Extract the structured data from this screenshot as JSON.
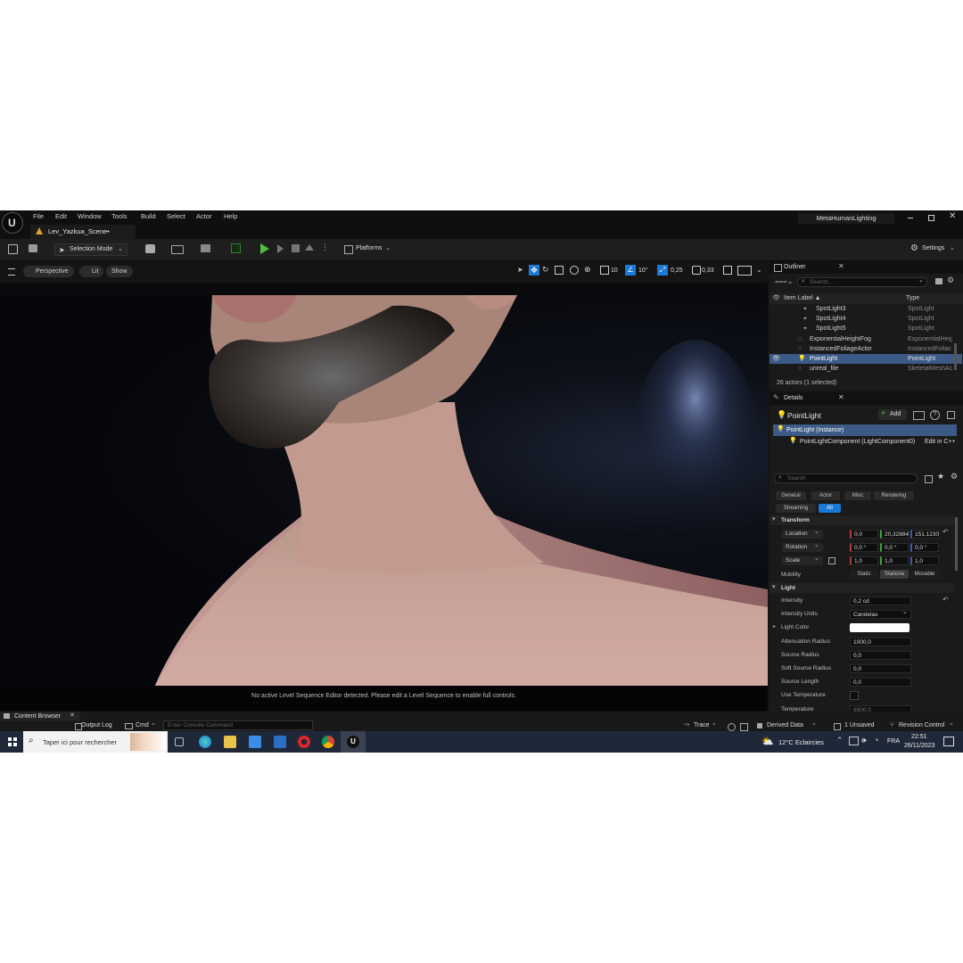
{
  "window": {
    "tab_title": "Lev_Yazkua_Scene•",
    "project_name": "MetaHumanLighting"
  },
  "menu": [
    "File",
    "Edit",
    "Window",
    "Tools",
    "Build",
    "Select",
    "Actor",
    "Help"
  ],
  "toolbar": {
    "selection_mode": "Selection Mode",
    "platforms": "Platforms",
    "settings": "Settings"
  },
  "viewport": {
    "perspective": "Perspective",
    "lit": "Lit",
    "show": "Show",
    "grid_size": "10",
    "angle_snap": "10°",
    "scale_snap": "0,25",
    "camera_speed": "0,33",
    "message": "No active Level Sequence Editor detected. Please edit a Level Sequence to enable full controls."
  },
  "outliner": {
    "title": "Outliner",
    "search_placeholder": "Search...",
    "col_label": "Item Label ▲",
    "col_type": "Type",
    "rows": [
      {
        "label": "SpotLight3",
        "type": "SpotLight",
        "indent": 2,
        "selected": false
      },
      {
        "label": "SpotLight4",
        "type": "SpotLight",
        "indent": 2,
        "selected": false
      },
      {
        "label": "SpotLight5",
        "type": "SpotLight",
        "indent": 2,
        "selected": false
      },
      {
        "label": "ExponentialHeightFog",
        "type": "ExponentialHeig",
        "indent": 1,
        "selected": false
      },
      {
        "label": "InstancedFoliageActor",
        "type": "InstancedFoliac",
        "indent": 1,
        "selected": false
      },
      {
        "label": "PointLight",
        "type": "PointLight",
        "indent": 1,
        "selected": true
      },
      {
        "label": "unreal_file",
        "type": "SkeletalMeshAc",
        "indent": 1,
        "selected": false
      }
    ],
    "status": "26 actors (1 selected)"
  },
  "details": {
    "title": "Details",
    "actor_name": "PointLight",
    "add": "Add",
    "instance": "PointLight (Instance)",
    "component": "PointLightComponent (LightComponent0)",
    "edit_cpp": "Edit in C++",
    "search_placeholder": "Search",
    "categories": [
      "General",
      "Actor",
      "Misc",
      "Rendering",
      "Streaming",
      "All"
    ],
    "transform_header": "Transform",
    "location": {
      "label": "Location",
      "x": "0,0",
      "y": "20,32884",
      "z": "151,1230"
    },
    "rotation": {
      "label": "Rotation",
      "x": "0,0 °",
      "y": "0,0 °",
      "z": "0,0 °"
    },
    "scale": {
      "label": "Scale",
      "x": "1,0",
      "y": "1,0",
      "z": "1,0"
    },
    "mobility": {
      "label": "Mobility",
      "options": [
        "Static",
        "Stationa",
        "Movable"
      ],
      "selected": "Stationa"
    },
    "light_header": "Light",
    "props": [
      {
        "label": "Intensity",
        "value": "0,2 cd"
      },
      {
        "label": "Intensity Units",
        "value": "Candelas"
      },
      {
        "label": "Light Color",
        "value": ""
      },
      {
        "label": "Attenuation Radius",
        "value": "1000,0"
      },
      {
        "label": "Source Radius",
        "value": "0,0"
      },
      {
        "label": "Soft Source Radius",
        "value": "0,0"
      },
      {
        "label": "Source Length",
        "value": "0,0"
      },
      {
        "label": "Use Temperature",
        "value": ""
      },
      {
        "label": "Temperature",
        "value": "6500,0"
      }
    ]
  },
  "bottombar": {
    "content_browser": "Content Browser",
    "output_log": "Output Log",
    "cmd": "Cmd",
    "console_placeholder": "Enter Console Command",
    "trace": "Trace",
    "derived_data": "Derived Data",
    "unsaved": "1 Unsaved",
    "revision_control": "Revision Control"
  },
  "taskbar": {
    "search": "Taper ici pour rechercher",
    "weather": "12°C  Eclaircies",
    "lang": "FRA",
    "time": "22:51",
    "date": "26/11/2023"
  },
  "colors": {
    "accent": "#1a78d6",
    "selected_row": "#3b5a86",
    "play_green": "#4fbf3a"
  }
}
